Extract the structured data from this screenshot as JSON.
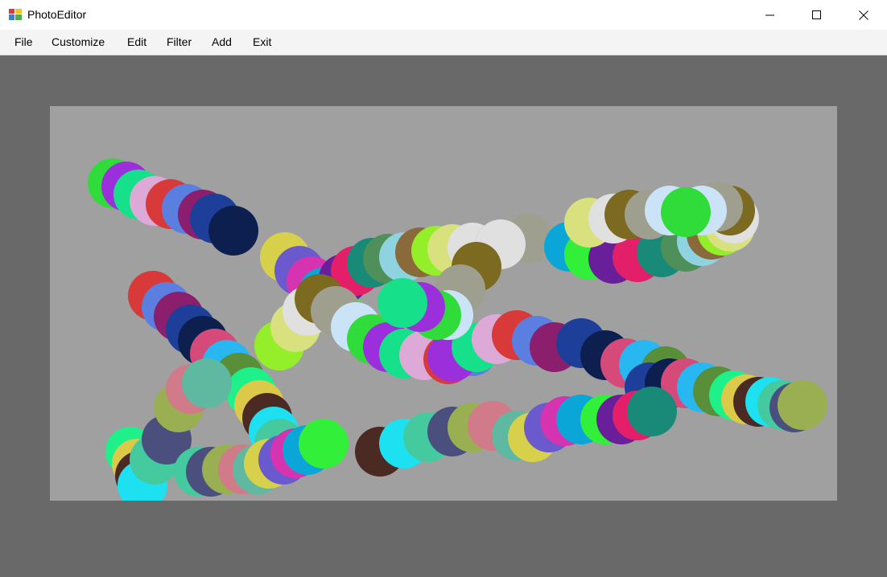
{
  "window": {
    "title": "PhotoEditor",
    "icon": "photo-editor-app-icon",
    "controls": [
      "minimize-icon",
      "maximize-icon",
      "close-icon"
    ]
  },
  "menu": {
    "file": "File",
    "customize": "Customize",
    "edit": "Edit",
    "filter": "Filter",
    "add": "Add",
    "exit": "Exit"
  },
  "colors": {
    "workspace": "#696969",
    "canvas": "#a0a0a0",
    "menubar": "#f4f4f4"
  }
}
